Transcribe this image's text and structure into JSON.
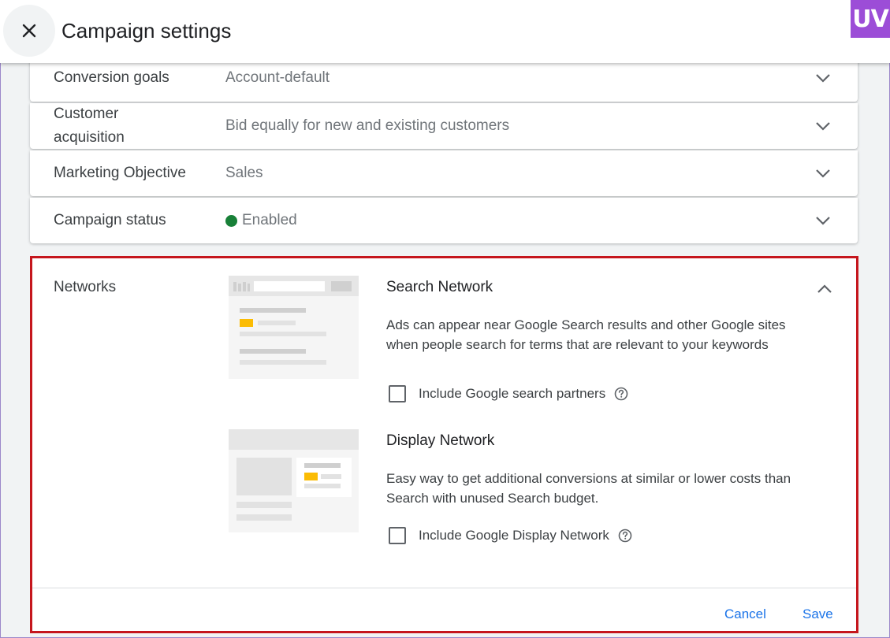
{
  "header": {
    "title": "Campaign settings",
    "logo_text": "UV"
  },
  "rows": [
    {
      "label": "Conversion goals",
      "value": "Account-default"
    },
    {
      "label": "Customer acquisition",
      "value": "Bid equally for new and existing customers"
    },
    {
      "label": "Marketing Objective",
      "value": "Sales"
    },
    {
      "label": "Campaign status",
      "value": "Enabled",
      "status_color": "#188038"
    }
  ],
  "networks": {
    "label": "Networks",
    "search": {
      "title": "Search Network",
      "description": "Ads can appear near Google Search results and other Google sites when people search for terms that are relevant to your keywords",
      "checkbox_label": "Include Google search partners",
      "checked": false
    },
    "display": {
      "title": "Display Network",
      "description": "Easy way to get additional conversions at similar or lower costs than Search with unused Search budget.",
      "checkbox_label": "Include Google Display Network",
      "checked": false
    },
    "cancel_label": "Cancel",
    "save_label": "Save"
  },
  "colors": {
    "accent": "#1a73e8",
    "highlight_border": "#c5161d",
    "ad_yellow": "#fbbc04"
  }
}
